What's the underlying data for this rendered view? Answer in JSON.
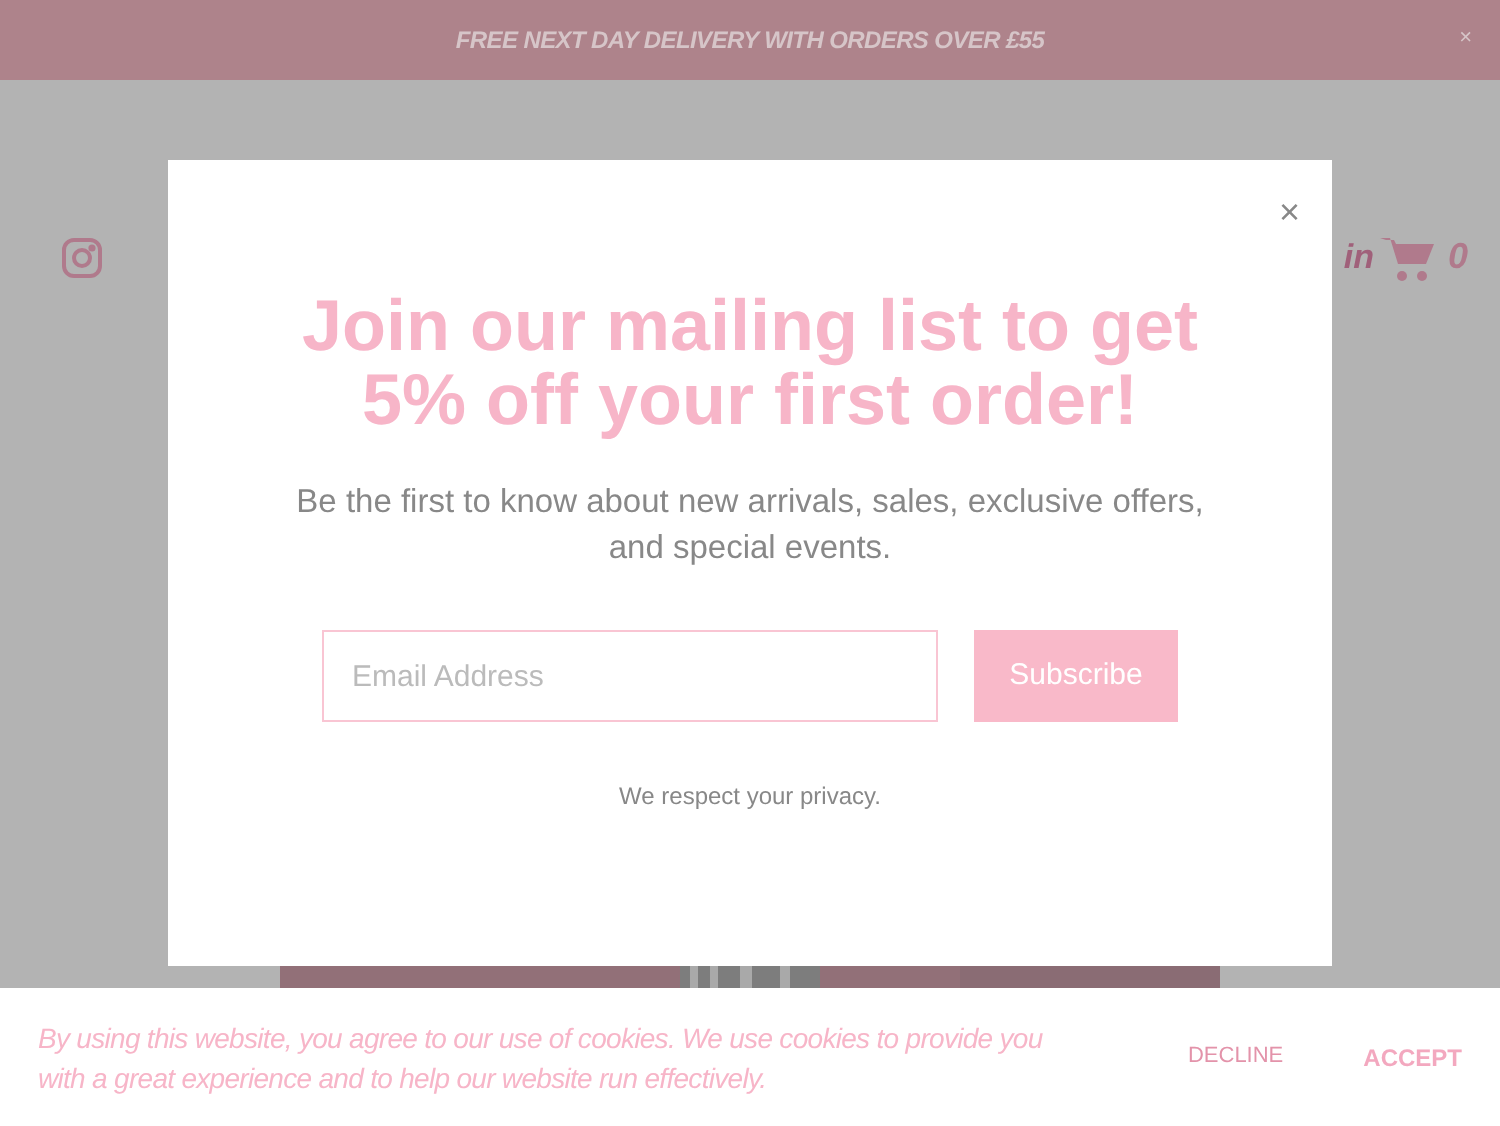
{
  "announcement": {
    "text": "FREE NEXT DAY DELIVERY WITH ORDERS OVER £55",
    "close": "×"
  },
  "header": {
    "account_link": "in",
    "cart_count": "0"
  },
  "popup": {
    "close": "×",
    "title": "Join our mailing list to get 5% off your first order!",
    "subtitle": "Be the first to know about new arrivals, sales, exclusive offers, and special events.",
    "email": {
      "placeholder": "Email Address"
    },
    "button": "Subscribe",
    "privacy": "We respect your privacy."
  },
  "cookie_bar": {
    "text": "By using this website, you agree to our use of cookies. We use cookies to provide you with a great experience and to help our website run effectively.",
    "decline": "DECLINE",
    "accept": "ACCEPT"
  }
}
